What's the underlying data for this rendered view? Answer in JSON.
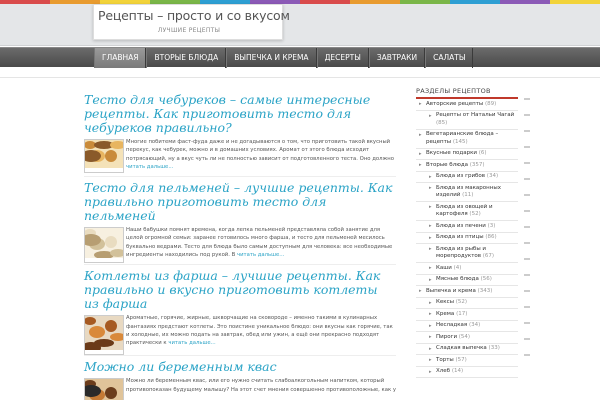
{
  "header": {
    "site_title": "Рецепты – просто и со вкусом",
    "tagline": "ЛУЧШИЕ РЕЦЕПТЫ",
    "stripe_colors": [
      "#d94b4b",
      "#e89b2f",
      "#f2d33a",
      "#7ab648",
      "#2e9fd3",
      "#8b5ab6",
      "#d94b4b",
      "#e89b2f",
      "#7ab648",
      "#2e9fd3",
      "#8b5ab6",
      "#f2d33a"
    ]
  },
  "nav": {
    "items": [
      "ГЛАВНАЯ",
      "ВТОРЫЕ БЛЮДА",
      "ВЫПЕЧКА И КРЕМА",
      "ДЕСЕРТЫ",
      "ЗАВТРАКИ",
      "САЛАТЫ"
    ],
    "active_index": 0
  },
  "posts": [
    {
      "title": "Тесто для чебуреков – самые интересные рецепты. Как приготовить тесто для чебуреков правильно?",
      "excerpt": "Многие побитеми фаст-фуда даже и не догадываются о том, что приготовить такой вкусный перекус, как чебурек, можно и в домашних условиях. Аромат от этого блюда исходит потрясающий, ну а вкус чуть ли не полностью зависит от подготовленного теста. Оно должно",
      "more": "читать дальше...",
      "thumb": "chebureki-photo"
    },
    {
      "title": "Тесто для пельменей – лучшие рецепты. Как правильно приготовить тесто для пельменей",
      "excerpt": "Наши бабушки помнят времена, когда лепка пельменей представляла собой занятие для целой огромной семьи: заранее готовилось много фарша, и тесто для пельменей месилось буквально ведрами. Тесто для блюда было самым доступным для человека: все необходимые ингредиенты находились под рукой. В",
      "more": "читать дальше...",
      "thumb": "pelmeni-photo"
    },
    {
      "title": "Котлеты из фарша – лучшие рецепты. Как правильно и вкусно приготовить котлеты из фарша",
      "excerpt": "Ароматные, горячие, жирные, шкворчащие на сковороде – именно такими в кулинарных фантазиях предстают котлеты. Это поистине уникальное блюдо: они вкусны как горячие, так и холодные, их можно подать на завтрак, обед или ужин, а ещё они прекрасно подходят практически к",
      "more": "читать дальше...",
      "thumb": "kotlety-photo"
    },
    {
      "title": "Можно ли беременным квас",
      "excerpt": "Можно ли беременным квас, или его нужно считать слабоалкогольным напитком, который противопоказан будущему малышу? На этот счет мнения совершенно противоположные, как у",
      "more": "",
      "thumb": "kvas-photo"
    }
  ],
  "sidebar": {
    "heading": "РАЗДЕЛЫ РЕЦЕПТОВ",
    "items": [
      {
        "label": "Авторские рецепты",
        "count": "(89)",
        "level": 1,
        "marker": "arrow"
      },
      {
        "label": "Рецепты от Натальи Чагай",
        "count": "(85)",
        "level": 2,
        "marker": "arrow"
      },
      {
        "label": "Вегетарианские блюда – рецепты",
        "count": "(145)",
        "level": 1,
        "marker": "arrow"
      },
      {
        "label": "Вкусные подарки",
        "count": "(6)",
        "level": 1,
        "marker": "arrow"
      },
      {
        "label": "Вторые блюда",
        "count": "(357)",
        "level": 1,
        "marker": "arrow"
      },
      {
        "label": "Блюда из грибов",
        "count": "(34)",
        "level": 2,
        "marker": "arrow"
      },
      {
        "label": "Блюда из макаронных изделий",
        "count": "(11)",
        "level": 2,
        "marker": "arrow"
      },
      {
        "label": "Блюда из овощей и картофеля",
        "count": "(52)",
        "level": 2,
        "marker": "arrow"
      },
      {
        "label": "Блюда из печени",
        "count": "(3)",
        "level": 2,
        "marker": "arrow"
      },
      {
        "label": "Блюда из птицы",
        "count": "(86)",
        "level": 2,
        "marker": "arrow"
      },
      {
        "label": "Блюда из рыбы и морепродуктов",
        "count": "(67)",
        "level": 2,
        "marker": "arrow"
      },
      {
        "label": "Каши",
        "count": "(4)",
        "level": 2,
        "marker": "arrow"
      },
      {
        "label": "Мясные блюда",
        "count": "(56)",
        "level": 2,
        "marker": "arrow"
      },
      {
        "label": "Выпечка и крема",
        "count": "(343)",
        "level": 1,
        "marker": "arrow"
      },
      {
        "label": "Кексы",
        "count": "(52)",
        "level": 2,
        "marker": "arrow"
      },
      {
        "label": "Крема",
        "count": "(17)",
        "level": 2,
        "marker": "arrow"
      },
      {
        "label": "Несладкая",
        "count": "(34)",
        "level": 2,
        "marker": "arrow"
      },
      {
        "label": "Пироги",
        "count": "(54)",
        "level": 2,
        "marker": "arrow"
      },
      {
        "label": "Сладкая выпечка",
        "count": "(33)",
        "level": 2,
        "marker": "arrow"
      },
      {
        "label": "Торты",
        "count": "(57)",
        "level": 2,
        "marker": "arrow"
      },
      {
        "label": "Хлеб",
        "count": "(14)",
        "level": 2,
        "marker": "arrow"
      }
    ]
  },
  "colors": {
    "accent": "#2aa3c6",
    "nav_bg": "#555555",
    "sidebar_rule": "#c0392b"
  }
}
